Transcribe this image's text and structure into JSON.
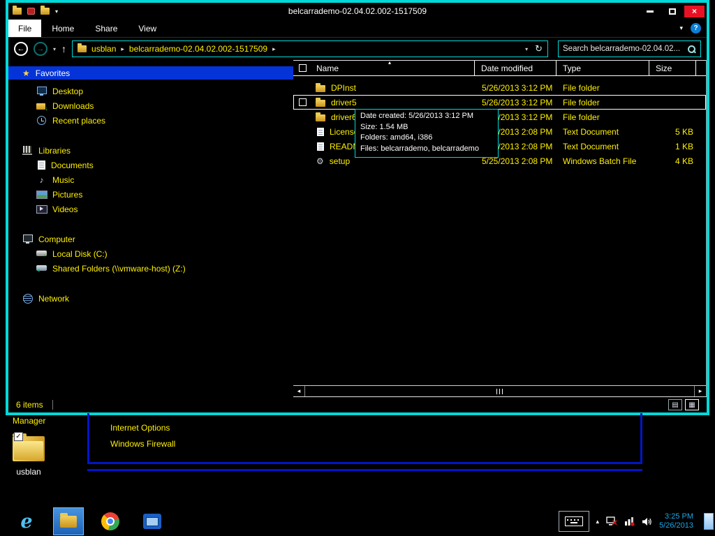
{
  "titlebar": {
    "title": "belcarrademo-02.04.02.002-1517509"
  },
  "ribbon": {
    "tabs": [
      "File",
      "Home",
      "Share",
      "View"
    ]
  },
  "navbar": {
    "crumbs": [
      "usblan",
      "belcarrademo-02.04.02.002-1517509"
    ],
    "search_placeholder": "Search belcarrademo-02.04.02..."
  },
  "sidebar": {
    "favorites": {
      "label": "Favorites",
      "items": [
        "Desktop",
        "Downloads",
        "Recent places"
      ]
    },
    "libraries": {
      "label": "Libraries",
      "items": [
        "Documents",
        "Music",
        "Pictures",
        "Videos"
      ]
    },
    "computer": {
      "label": "Computer",
      "items": [
        "Local Disk (C:)",
        "Shared Folders (\\\\vmware-host) (Z:)"
      ]
    },
    "network": {
      "label": "Network"
    }
  },
  "filelist": {
    "columns": [
      "Name",
      "Date modified",
      "Type",
      "Size"
    ],
    "rows": [
      {
        "name": "DPInst",
        "date": "5/26/2013 3:12 PM",
        "type": "File folder",
        "size": "",
        "icon": "folder-icon"
      },
      {
        "name": "driver5",
        "date": "5/26/2013 3:12 PM",
        "type": "File folder",
        "size": "",
        "icon": "folder-icon",
        "selected": true
      },
      {
        "name": "driver6",
        "date": "5/26/2013 3:12 PM",
        "type": "File folder",
        "size": "",
        "icon": "folder-icon"
      },
      {
        "name": "License",
        "date": "5/25/2013 2:08 PM",
        "type": "Text Document",
        "size": "5 KB",
        "icon": "document-icon"
      },
      {
        "name": "README",
        "date": "5/25/2013 2:08 PM",
        "type": "Text Document",
        "size": "1 KB",
        "icon": "document-icon"
      },
      {
        "name": "setup",
        "date": "5/25/2013 2:08 PM",
        "type": "Windows Batch File",
        "size": "4 KB",
        "icon": "batch-gear-icon"
      }
    ]
  },
  "tooltip": {
    "lines": [
      "Date created: 5/26/2013 3:12 PM",
      "Size: 1.54 MB",
      "Folders: amd64, i386",
      "Files: belcarrademo, belcarrademo"
    ]
  },
  "statusbar": {
    "count": "6 items"
  },
  "desktop": {
    "partial_text": "Manager",
    "links": [
      "Internet Options",
      "Windows Firewall"
    ],
    "icon_label": "usblan"
  },
  "taskbar": {
    "time": "3:25 PM",
    "date": "5/26/2013"
  },
  "colors": {
    "accent_cyan": "#00d9d9",
    "text_yellow": "#fff000",
    "selection_blue": "#0433d8",
    "close_red": "#e81123"
  }
}
